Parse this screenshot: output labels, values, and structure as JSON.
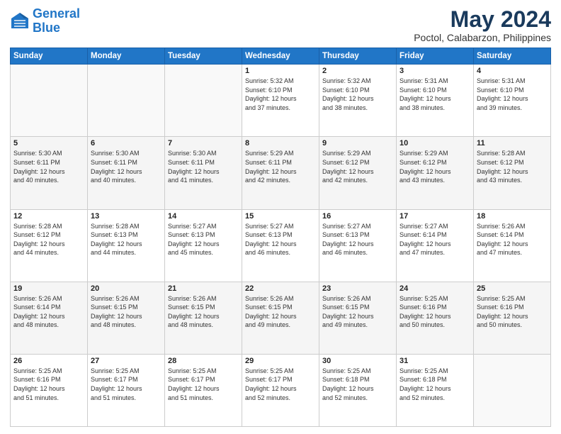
{
  "header": {
    "logo_line1": "General",
    "logo_line2": "Blue",
    "title": "May 2024",
    "subtitle": "Poctol, Calabarzon, Philippines"
  },
  "weekdays": [
    "Sunday",
    "Monday",
    "Tuesday",
    "Wednesday",
    "Thursday",
    "Friday",
    "Saturday"
  ],
  "weeks": [
    [
      {
        "day": "",
        "info": ""
      },
      {
        "day": "",
        "info": ""
      },
      {
        "day": "",
        "info": ""
      },
      {
        "day": "1",
        "info": "Sunrise: 5:32 AM\nSunset: 6:10 PM\nDaylight: 12 hours\nand 37 minutes."
      },
      {
        "day": "2",
        "info": "Sunrise: 5:32 AM\nSunset: 6:10 PM\nDaylight: 12 hours\nand 38 minutes."
      },
      {
        "day": "3",
        "info": "Sunrise: 5:31 AM\nSunset: 6:10 PM\nDaylight: 12 hours\nand 38 minutes."
      },
      {
        "day": "4",
        "info": "Sunrise: 5:31 AM\nSunset: 6:10 PM\nDaylight: 12 hours\nand 39 minutes."
      }
    ],
    [
      {
        "day": "5",
        "info": "Sunrise: 5:30 AM\nSunset: 6:11 PM\nDaylight: 12 hours\nand 40 minutes."
      },
      {
        "day": "6",
        "info": "Sunrise: 5:30 AM\nSunset: 6:11 PM\nDaylight: 12 hours\nand 40 minutes."
      },
      {
        "day": "7",
        "info": "Sunrise: 5:30 AM\nSunset: 6:11 PM\nDaylight: 12 hours\nand 41 minutes."
      },
      {
        "day": "8",
        "info": "Sunrise: 5:29 AM\nSunset: 6:11 PM\nDaylight: 12 hours\nand 42 minutes."
      },
      {
        "day": "9",
        "info": "Sunrise: 5:29 AM\nSunset: 6:12 PM\nDaylight: 12 hours\nand 42 minutes."
      },
      {
        "day": "10",
        "info": "Sunrise: 5:29 AM\nSunset: 6:12 PM\nDaylight: 12 hours\nand 43 minutes."
      },
      {
        "day": "11",
        "info": "Sunrise: 5:28 AM\nSunset: 6:12 PM\nDaylight: 12 hours\nand 43 minutes."
      }
    ],
    [
      {
        "day": "12",
        "info": "Sunrise: 5:28 AM\nSunset: 6:12 PM\nDaylight: 12 hours\nand 44 minutes."
      },
      {
        "day": "13",
        "info": "Sunrise: 5:28 AM\nSunset: 6:13 PM\nDaylight: 12 hours\nand 44 minutes."
      },
      {
        "day": "14",
        "info": "Sunrise: 5:27 AM\nSunset: 6:13 PM\nDaylight: 12 hours\nand 45 minutes."
      },
      {
        "day": "15",
        "info": "Sunrise: 5:27 AM\nSunset: 6:13 PM\nDaylight: 12 hours\nand 46 minutes."
      },
      {
        "day": "16",
        "info": "Sunrise: 5:27 AM\nSunset: 6:13 PM\nDaylight: 12 hours\nand 46 minutes."
      },
      {
        "day": "17",
        "info": "Sunrise: 5:27 AM\nSunset: 6:14 PM\nDaylight: 12 hours\nand 47 minutes."
      },
      {
        "day": "18",
        "info": "Sunrise: 5:26 AM\nSunset: 6:14 PM\nDaylight: 12 hours\nand 47 minutes."
      }
    ],
    [
      {
        "day": "19",
        "info": "Sunrise: 5:26 AM\nSunset: 6:14 PM\nDaylight: 12 hours\nand 48 minutes."
      },
      {
        "day": "20",
        "info": "Sunrise: 5:26 AM\nSunset: 6:15 PM\nDaylight: 12 hours\nand 48 minutes."
      },
      {
        "day": "21",
        "info": "Sunrise: 5:26 AM\nSunset: 6:15 PM\nDaylight: 12 hours\nand 48 minutes."
      },
      {
        "day": "22",
        "info": "Sunrise: 5:26 AM\nSunset: 6:15 PM\nDaylight: 12 hours\nand 49 minutes."
      },
      {
        "day": "23",
        "info": "Sunrise: 5:26 AM\nSunset: 6:15 PM\nDaylight: 12 hours\nand 49 minutes."
      },
      {
        "day": "24",
        "info": "Sunrise: 5:25 AM\nSunset: 6:16 PM\nDaylight: 12 hours\nand 50 minutes."
      },
      {
        "day": "25",
        "info": "Sunrise: 5:25 AM\nSunset: 6:16 PM\nDaylight: 12 hours\nand 50 minutes."
      }
    ],
    [
      {
        "day": "26",
        "info": "Sunrise: 5:25 AM\nSunset: 6:16 PM\nDaylight: 12 hours\nand 51 minutes."
      },
      {
        "day": "27",
        "info": "Sunrise: 5:25 AM\nSunset: 6:17 PM\nDaylight: 12 hours\nand 51 minutes."
      },
      {
        "day": "28",
        "info": "Sunrise: 5:25 AM\nSunset: 6:17 PM\nDaylight: 12 hours\nand 51 minutes."
      },
      {
        "day": "29",
        "info": "Sunrise: 5:25 AM\nSunset: 6:17 PM\nDaylight: 12 hours\nand 52 minutes."
      },
      {
        "day": "30",
        "info": "Sunrise: 5:25 AM\nSunset: 6:18 PM\nDaylight: 12 hours\nand 52 minutes."
      },
      {
        "day": "31",
        "info": "Sunrise: 5:25 AM\nSunset: 6:18 PM\nDaylight: 12 hours\nand 52 minutes."
      },
      {
        "day": "",
        "info": ""
      }
    ]
  ]
}
